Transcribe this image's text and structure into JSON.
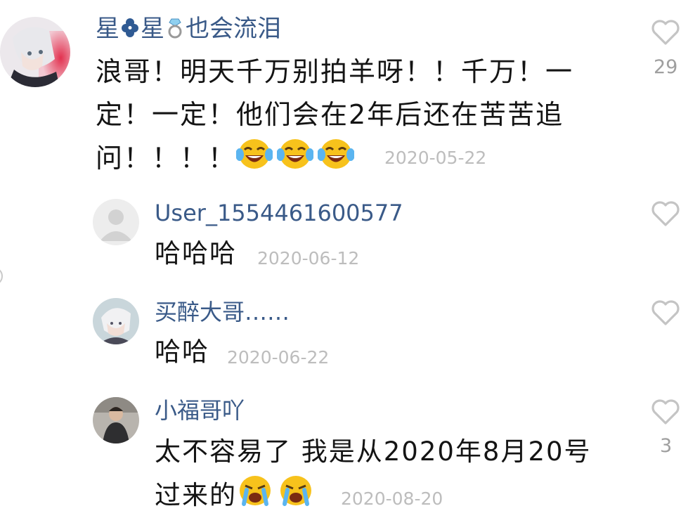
{
  "comments": [
    {
      "name_part1": "星",
      "name_part2": "星",
      "name_part3": "也会流泪",
      "name_icons": [
        "clover-icon",
        "ring-icon"
      ],
      "line1": "浪哥！明天千万别拍羊呀！！千万！一",
      "line2": "定！一定！他们会在2年后还在苦苦追",
      "line3": "问！！！！",
      "emojis": [
        "laughing-crying-emoji",
        "laughing-crying-emoji",
        "laughing-crying-emoji"
      ],
      "date": "2020-05-22",
      "like_count": "29"
    },
    {
      "name": "User_1554461600577",
      "text": "哈哈哈",
      "date": "2020-06-12"
    },
    {
      "name": "买醉大哥……",
      "text": "哈哈",
      "date": "2020-06-22"
    },
    {
      "name": "小福哥吖",
      "line1": "太不容易了 我是从2020年8月20号",
      "line2": "过来的",
      "emojis": [
        "loudly-crying-emoji",
        "loudly-crying-emoji"
      ],
      "date": "2020-08-20",
      "like_count": "3"
    }
  ],
  "colors": {
    "username": "#3a5a88",
    "text": "#141414",
    "date": "#bdbdbd",
    "heart": "#c4c4c4",
    "emoji_face": "#f7c21c"
  }
}
